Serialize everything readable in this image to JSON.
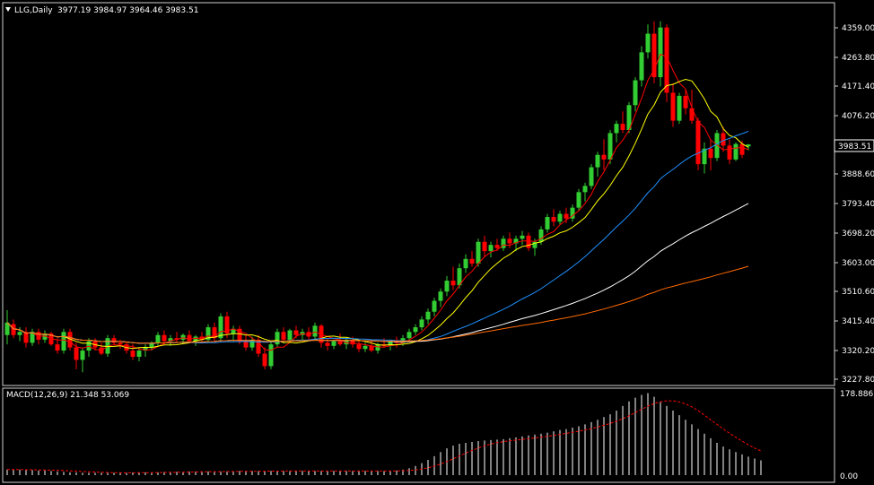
{
  "main_panel": {
    "symbol": "LLG,Daily",
    "ohlc": "3977.19 3984.97 3964.46 3983.51",
    "current_price_label": "3983.51",
    "price_axis_ticks": [
      "4359.00",
      "4263.80",
      "4171.40",
      "4076.20",
      "3888.60",
      "3793.40",
      "3698.20",
      "3603.00",
      "3510.60",
      "3415.40",
      "3320.20",
      "3227.80"
    ]
  },
  "macd_panel": {
    "label": "MACD(12,26,9) 21.348 53.069",
    "axis_top": "178.886",
    "axis_bottom": "0.00"
  },
  "colors": {
    "background": "#000000",
    "bull_candle": "#32cd32",
    "bear_candle": "#ff0000",
    "ma_red": "#ff0000",
    "ma_yellow": "#ffff00",
    "ma_blue": "#1e90ff",
    "ma_white": "#ffffff",
    "ma_orange": "#ff6a00",
    "macd_hist": "#ffffff",
    "macd_signal": "#ff0000"
  },
  "chart_data": {
    "type": "candlestick",
    "timeframe": "Daily",
    "y_range": [
      3227.8,
      4359.0
    ],
    "candles": [
      [
        3370,
        3450,
        3340,
        3410
      ],
      [
        3405,
        3420,
        3360,
        3370
      ],
      [
        3370,
        3395,
        3350,
        3380
      ],
      [
        3380,
        3395,
        3330,
        3345
      ],
      [
        3345,
        3390,
        3335,
        3380
      ],
      [
        3380,
        3390,
        3340,
        3355
      ],
      [
        3355,
        3385,
        3345,
        3375
      ],
      [
        3375,
        3380,
        3335,
        3340
      ],
      [
        3340,
        3360,
        3310,
        3320
      ],
      [
        3320,
        3390,
        3310,
        3380
      ],
      [
        3380,
        3390,
        3320,
        3330
      ],
      [
        3330,
        3345,
        3260,
        3290
      ],
      [
        3290,
        3330,
        3250,
        3320
      ],
      [
        3320,
        3360,
        3300,
        3350
      ],
      [
        3350,
        3360,
        3320,
        3330
      ],
      [
        3330,
        3345,
        3305,
        3310
      ],
      [
        3310,
        3370,
        3300,
        3360
      ],
      [
        3360,
        3370,
        3340,
        3345
      ],
      [
        3345,
        3355,
        3325,
        3340
      ],
      [
        3340,
        3350,
        3310,
        3320
      ],
      [
        3320,
        3340,
        3290,
        3300
      ],
      [
        3300,
        3330,
        3285,
        3320
      ],
      [
        3320,
        3340,
        3300,
        3330
      ],
      [
        3330,
        3350,
        3320,
        3345
      ],
      [
        3345,
        3380,
        3335,
        3370
      ],
      [
        3370,
        3385,
        3340,
        3350
      ],
      [
        3350,
        3370,
        3335,
        3360
      ],
      [
        3360,
        3380,
        3345,
        3355
      ],
      [
        3355,
        3375,
        3340,
        3370
      ],
      [
        3370,
        3385,
        3345,
        3350
      ],
      [
        3350,
        3370,
        3335,
        3365
      ],
      [
        3365,
        3380,
        3345,
        3355
      ],
      [
        3355,
        3405,
        3345,
        3395
      ],
      [
        3395,
        3410,
        3350,
        3360
      ],
      [
        3360,
        3440,
        3350,
        3430
      ],
      [
        3430,
        3445,
        3360,
        3375
      ],
      [
        3375,
        3400,
        3350,
        3390
      ],
      [
        3390,
        3400,
        3340,
        3350
      ],
      [
        3350,
        3370,
        3320,
        3330
      ],
      [
        3330,
        3365,
        3320,
        3355
      ],
      [
        3355,
        3370,
        3300,
        3310
      ],
      [
        3310,
        3330,
        3260,
        3270
      ],
      [
        3270,
        3350,
        3260,
        3340
      ],
      [
        3340,
        3390,
        3330,
        3380
      ],
      [
        3380,
        3395,
        3350,
        3355
      ],
      [
        3355,
        3390,
        3345,
        3385
      ],
      [
        3385,
        3400,
        3360,
        3370
      ],
      [
        3370,
        3390,
        3350,
        3380
      ],
      [
        3380,
        3395,
        3355,
        3365
      ],
      [
        3365,
        3410,
        3355,
        3400
      ],
      [
        3400,
        3405,
        3330,
        3345
      ],
      [
        3345,
        3360,
        3320,
        3335
      ],
      [
        3335,
        3355,
        3325,
        3350
      ],
      [
        3350,
        3375,
        3335,
        3340
      ],
      [
        3340,
        3360,
        3325,
        3355
      ],
      [
        3355,
        3365,
        3330,
        3340
      ],
      [
        3340,
        3355,
        3315,
        3325
      ],
      [
        3325,
        3345,
        3315,
        3335
      ],
      [
        3335,
        3355,
        3315,
        3320
      ],
      [
        3320,
        3345,
        3310,
        3340
      ],
      [
        3340,
        3360,
        3330,
        3335
      ],
      [
        3335,
        3355,
        3320,
        3350
      ],
      [
        3350,
        3365,
        3330,
        3345
      ],
      [
        3345,
        3370,
        3335,
        3360
      ],
      [
        3360,
        3390,
        3350,
        3380
      ],
      [
        3380,
        3405,
        3370,
        3395
      ],
      [
        3395,
        3430,
        3385,
        3420
      ],
      [
        3420,
        3455,
        3405,
        3445
      ],
      [
        3445,
        3490,
        3430,
        3480
      ],
      [
        3480,
        3520,
        3460,
        3510
      ],
      [
        3510,
        3560,
        3495,
        3545
      ],
      [
        3545,
        3590,
        3515,
        3530
      ],
      [
        3530,
        3600,
        3520,
        3585
      ],
      [
        3585,
        3630,
        3570,
        3615
      ],
      [
        3615,
        3640,
        3590,
        3600
      ],
      [
        3600,
        3680,
        3590,
        3670
      ],
      [
        3670,
        3690,
        3620,
        3640
      ],
      [
        3640,
        3670,
        3620,
        3660
      ],
      [
        3660,
        3680,
        3640,
        3650
      ],
      [
        3650,
        3690,
        3640,
        3680
      ],
      [
        3680,
        3700,
        3650,
        3665
      ],
      [
        3665,
        3690,
        3640,
        3680
      ],
      [
        3680,
        3705,
        3660,
        3690
      ],
      [
        3690,
        3700,
        3640,
        3650
      ],
      [
        3650,
        3680,
        3625,
        3670
      ],
      [
        3670,
        3720,
        3660,
        3710
      ],
      [
        3710,
        3760,
        3700,
        3750
      ],
      [
        3750,
        3775,
        3720,
        3735
      ],
      [
        3735,
        3770,
        3725,
        3760
      ],
      [
        3760,
        3780,
        3730,
        3745
      ],
      [
        3745,
        3790,
        3735,
        3780
      ],
      [
        3780,
        3840,
        3770,
        3830
      ],
      [
        3830,
        3860,
        3800,
        3850
      ],
      [
        3850,
        3920,
        3840,
        3910
      ],
      [
        3910,
        3960,
        3880,
        3950
      ],
      [
        3950,
        4000,
        3900,
        3935
      ],
      [
        3935,
        4030,
        3920,
        4020
      ],
      [
        4020,
        4060,
        3990,
        4050
      ],
      [
        4050,
        4090,
        4020,
        4030
      ],
      [
        4030,
        4120,
        4020,
        4110
      ],
      [
        4110,
        4200,
        4090,
        4190
      ],
      [
        4190,
        4300,
        4170,
        4280
      ],
      [
        4280,
        4370,
        4260,
        4340
      ],
      [
        4340,
        4380,
        4180,
        4200
      ],
      [
        4200,
        4380,
        4170,
        4360
      ],
      [
        4360,
        4370,
        4120,
        4150
      ],
      [
        4150,
        4180,
        4040,
        4060
      ],
      [
        4060,
        4150,
        4050,
        4140
      ],
      [
        4140,
        4160,
        4080,
        4100
      ],
      [
        4100,
        4160,
        4050,
        4060
      ],
      [
        4060,
        4070,
        3900,
        3920
      ],
      [
        3920,
        3990,
        3890,
        3970
      ],
      [
        3970,
        4000,
        3900,
        3940
      ],
      [
        3940,
        4030,
        3930,
        4020
      ],
      [
        4020,
        4040,
        3960,
        3980
      ],
      [
        3980,
        4000,
        3920,
        3935
      ],
      [
        3935,
        3990,
        3930,
        3985
      ],
      [
        3985,
        3995,
        3940,
        3950
      ],
      [
        3977.19,
        3984.97,
        3964.46,
        3983.51
      ]
    ],
    "moving_averages": [
      {
        "color_key": "ma_red",
        "start": [
          3370,
          3600
        ],
        "end": [
          4000,
          4300
        ]
      },
      {
        "color_key": "ma_yellow",
        "start": [
          3385,
          3500
        ],
        "end": [
          3990,
          4180
        ]
      },
      {
        "color_key": "ma_blue",
        "start": [
          3300,
          3400
        ],
        "end": [
          3860,
          3870
        ]
      },
      {
        "color_key": "ma_white",
        "start": [
          3220,
          3300
        ],
        "end": [
          3600,
          3600
        ]
      },
      {
        "color_key": "ma_orange",
        "start": [
          3200,
          3280
        ],
        "end": [
          3365,
          3365
        ]
      }
    ],
    "macd_histogram": [
      12,
      12,
      12,
      11,
      11,
      10,
      10,
      9,
      8,
      7,
      6,
      6,
      5,
      5,
      5,
      5,
      5,
      5,
      5,
      5,
      6,
      6,
      6,
      6,
      6,
      7,
      7,
      7,
      7,
      8,
      8,
      8,
      8,
      8,
      8,
      8,
      8,
      9,
      9,
      9,
      9,
      9,
      9,
      9,
      9,
      9,
      9,
      9,
      9,
      9,
      9,
      9,
      9,
      9,
      9,
      9,
      9,
      9,
      9,
      9,
      9,
      9,
      10,
      12,
      15,
      20,
      26,
      33,
      41,
      50,
      58,
      64,
      68,
      70,
      72,
      74,
      75,
      76,
      77,
      78,
      80,
      82,
      84,
      86,
      88,
      90,
      92,
      95,
      98,
      100,
      103,
      106,
      110,
      115,
      120,
      126,
      132,
      140,
      150,
      160,
      168,
      174,
      178,
      170,
      160,
      150,
      140,
      130,
      120,
      110,
      100,
      90,
      80,
      70,
      62,
      56,
      50,
      45,
      40,
      36,
      32
    ],
    "macd_signal_range": [
      0,
      178.886
    ]
  }
}
